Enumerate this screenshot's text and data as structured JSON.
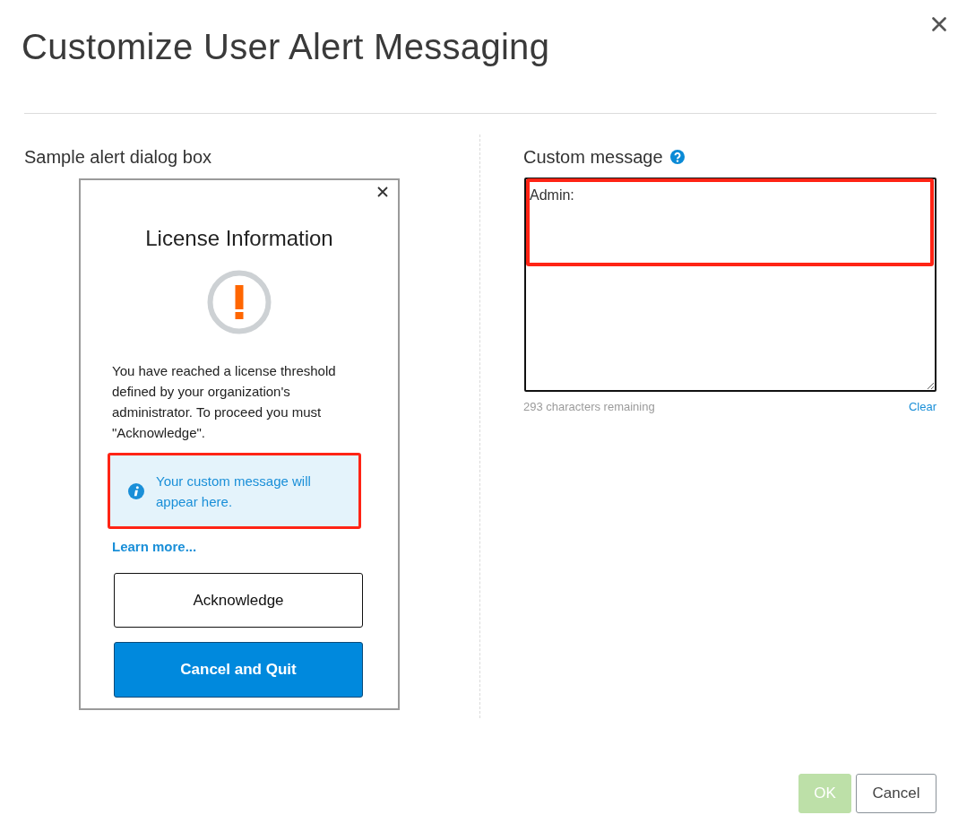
{
  "title": "Customize User Alert Messaging",
  "sample": {
    "heading": "Sample alert dialog box",
    "alert": {
      "title": "License Information",
      "message": "You have reached a license threshold defined by your organization's administrator. To proceed you must \"Acknowledge\".",
      "notice": {
        "text": "Your custom message will appear here.",
        "highlighted": true
      },
      "link": "Learn more...",
      "buttons": [
        {
          "label": "Acknowledge",
          "kind": "outline"
        },
        {
          "label": "Cancel and Quit",
          "kind": "primary"
        }
      ]
    }
  },
  "custom_message": {
    "label": "Custom message",
    "value": "Admin:",
    "highlighted": true,
    "remaining": "293 characters remaining",
    "clear": "Clear"
  },
  "footer_buttons": [
    {
      "label": "OK",
      "kind": "primary",
      "disabled": true
    },
    {
      "label": "Cancel",
      "kind": "secondary",
      "disabled": false
    }
  ]
}
